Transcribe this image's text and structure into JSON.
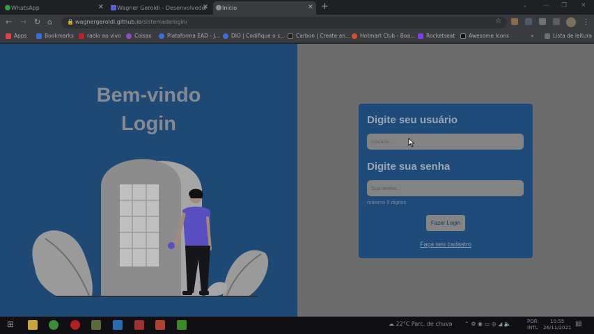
{
  "tabs": [
    {
      "title": "WhatsApp",
      "color": "#2aa149",
      "active": false
    },
    {
      "title": "Wagner Geroldi - Desenvolvedor",
      "color": "#5a5fd0",
      "active": false
    },
    {
      "title": "Início",
      "color": "#8a8d92",
      "active": true
    }
  ],
  "address": {
    "host": "wagnergeroldi.github.io",
    "path": "/sistemadelogin/"
  },
  "bookmarks": [
    {
      "label": "Apps",
      "color": "#d44"
    },
    {
      "label": "Bookmarks",
      "color": "#3a6fd8"
    },
    {
      "label": "radio ao vivo",
      "color": "#c0202c"
    },
    {
      "label": "Coisas",
      "color": "#8a4fc6"
    },
    {
      "label": "Plataforma EAD - J...",
      "color": "#3a6fd8"
    },
    {
      "label": "DIO | Codifique o s...",
      "color": "#3a6fd8"
    },
    {
      "label": "Carbon | Create an...",
      "color": "#222"
    },
    {
      "label": "Hotmart Club - Boa...",
      "color": "#d4502a"
    },
    {
      "label": "Rocketseat",
      "color": "#7b3fe4"
    },
    {
      "label": "Awesome Icons",
      "color": "#111"
    }
  ],
  "reading_list": "Lista de leitura",
  "welcome": {
    "line1": "Bem-vindo",
    "line2": "Login"
  },
  "form": {
    "user_heading": "Digite seu usuário",
    "user_placeholder": "Usuário...",
    "pass_heading": "Digite sua senha",
    "pass_placeholder": "Sua senha...",
    "hint": "máximo 8 digitos",
    "login_button": "Fazer Login",
    "signup_link": "Faça seu cadastro"
  },
  "taskbar": {
    "weather": "22°C  Parc. de chuva",
    "lang_top": "POR",
    "lang_bottom": "INTL",
    "time": "10:55",
    "date": "26/11/2021"
  },
  "colors": {
    "left_panel": "#1e4975",
    "card": "#1e4b7a",
    "right_panel": "#6c6c6c"
  }
}
